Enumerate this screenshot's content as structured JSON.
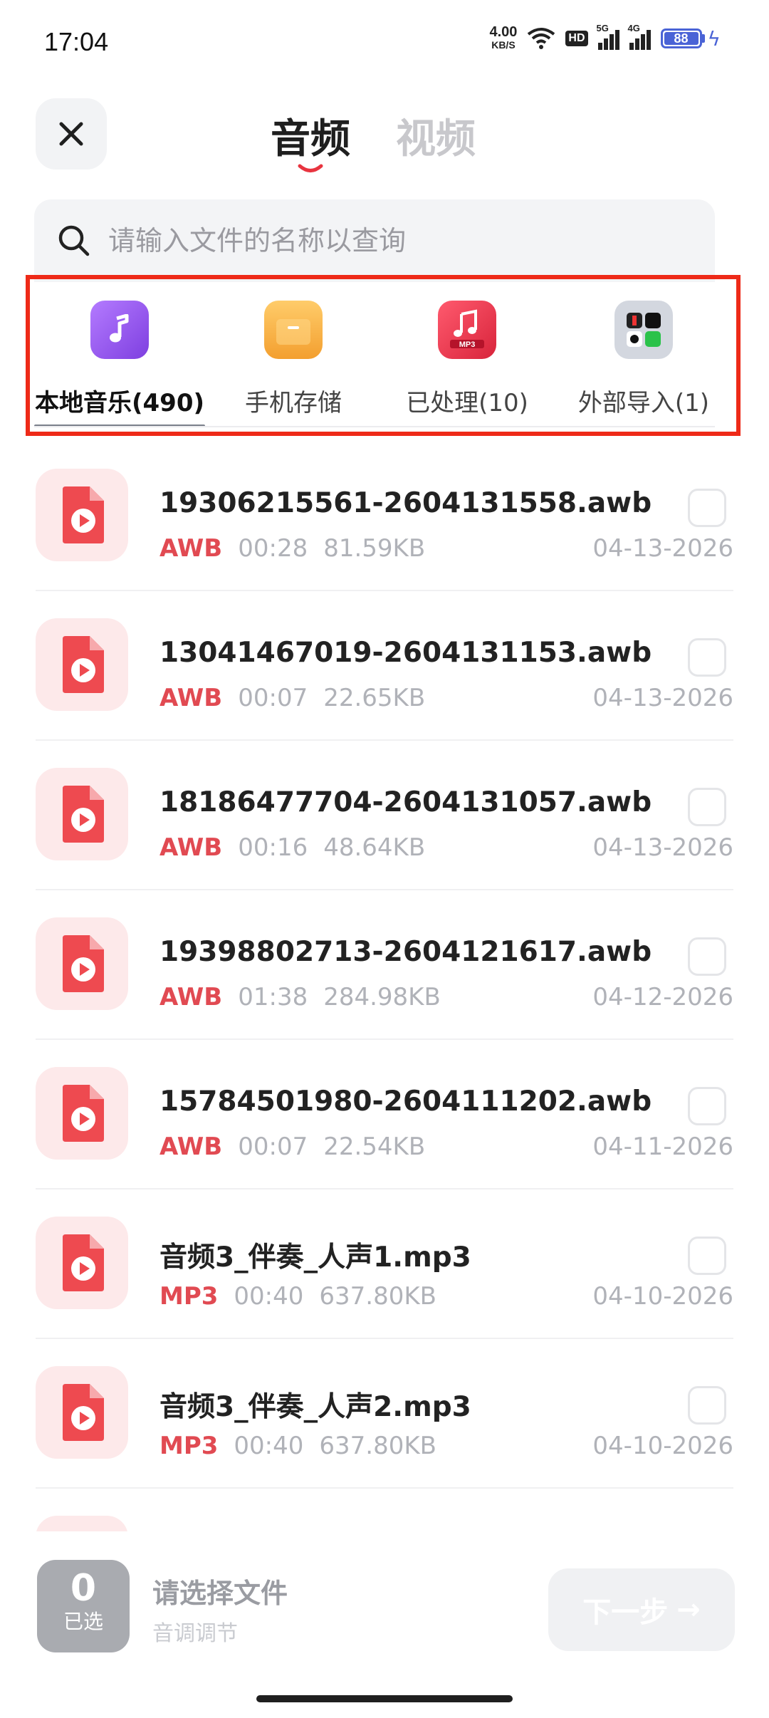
{
  "status": {
    "time": "17:04",
    "net_speed": "4.00",
    "net_unit": "KB/S",
    "hd": "HD",
    "sig1": "5G",
    "sig2": "4G",
    "battery": "88"
  },
  "header": {
    "tabs": [
      {
        "label": "音频",
        "active": true
      },
      {
        "label": "视频",
        "active": false
      }
    ]
  },
  "search": {
    "placeholder": "请输入文件的名称以查询"
  },
  "categories": [
    {
      "label": "本地音乐(490)",
      "icon": "music-note-icon",
      "color": "#9b5cf0",
      "active": true
    },
    {
      "label": "手机存储",
      "icon": "storage-icon",
      "color": "#f5b24a",
      "active": false
    },
    {
      "label": "已处理(10)",
      "icon": "mp3-icon",
      "color": "#ee3b55",
      "active": false
    },
    {
      "label": "外部导入(1)",
      "icon": "apps-grid-icon",
      "color": "#cfd3dc",
      "active": false
    }
  ],
  "files": [
    {
      "name": "19306215561-2604131558.awb",
      "format": "AWB",
      "duration": "00:28",
      "size": "81.59KB",
      "date": "04-13-2026"
    },
    {
      "name": "13041467019-2604131153.awb",
      "format": "AWB",
      "duration": "00:07",
      "size": "22.65KB",
      "date": "04-13-2026"
    },
    {
      "name": "18186477704-2604131057.awb",
      "format": "AWB",
      "duration": "00:16",
      "size": "48.64KB",
      "date": "04-13-2026"
    },
    {
      "name": "19398802713-2604121617.awb",
      "format": "AWB",
      "duration": "01:38",
      "size": "284.98KB",
      "date": "04-12-2026"
    },
    {
      "name": "15784501980-2604111202.awb",
      "format": "AWB",
      "duration": "00:07",
      "size": "22.54KB",
      "date": "04-11-2026"
    },
    {
      "name": "音频3_伴奏_人声1.mp3",
      "format": "MP3",
      "duration": "00:40",
      "size": "637.80KB",
      "date": "04-10-2026"
    },
    {
      "name": "音频3_伴奏_人声2.mp3",
      "format": "MP3",
      "duration": "00:40",
      "size": "637.80KB",
      "date": "04-10-2026"
    }
  ],
  "bottom": {
    "selected_count": "0",
    "selected_label": "已选",
    "title": "请选择文件",
    "subtitle": "音调调节",
    "next_label": "下一步"
  },
  "colors": {
    "accent": "#e14a52",
    "highlight_box": "#ee2a18"
  }
}
